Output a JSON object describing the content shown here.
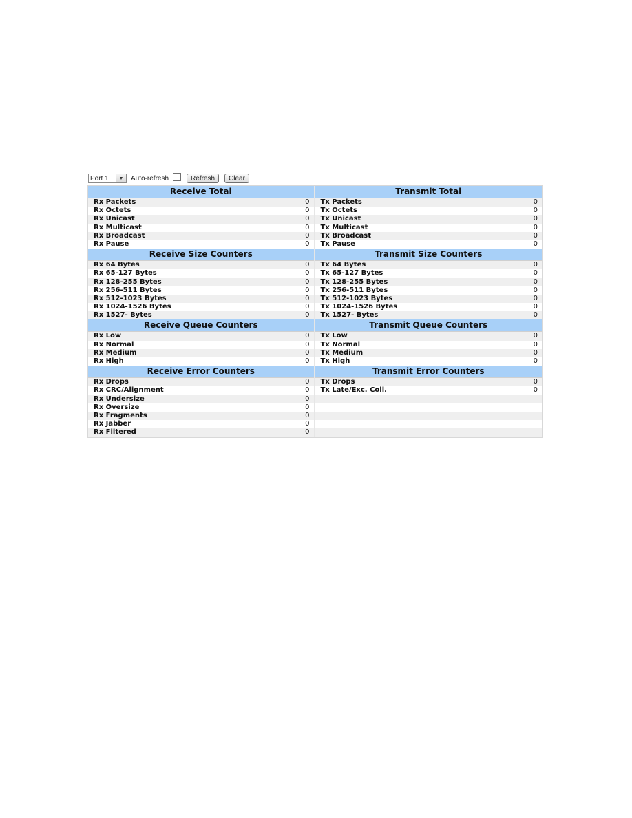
{
  "controls": {
    "port_select": "Port 1",
    "auto_refresh_label": "Auto-refresh",
    "auto_refresh_checked": false,
    "refresh_label": "Refresh",
    "clear_label": "Clear"
  },
  "sections": [
    {
      "rx_title": "Receive Total",
      "tx_title": "Transmit Total",
      "rx": [
        {
          "label": "Rx Packets",
          "value": "0"
        },
        {
          "label": "Rx Octets",
          "value": "0"
        },
        {
          "label": "Rx Unicast",
          "value": "0"
        },
        {
          "label": "Rx Multicast",
          "value": "0"
        },
        {
          "label": "Rx Broadcast",
          "value": "0"
        },
        {
          "label": "Rx Pause",
          "value": "0"
        }
      ],
      "tx": [
        {
          "label": "Tx Packets",
          "value": "0"
        },
        {
          "label": "Tx Octets",
          "value": "0"
        },
        {
          "label": "Tx Unicast",
          "value": "0"
        },
        {
          "label": "Tx Multicast",
          "value": "0"
        },
        {
          "label": "Tx Broadcast",
          "value": "0"
        },
        {
          "label": "Tx Pause",
          "value": "0"
        }
      ]
    },
    {
      "rx_title": "Receive Size Counters",
      "tx_title": "Transmit Size Counters",
      "rx": [
        {
          "label": "Rx 64 Bytes",
          "value": "0"
        },
        {
          "label": "Rx 65-127 Bytes",
          "value": "0"
        },
        {
          "label": "Rx 128-255 Bytes",
          "value": "0"
        },
        {
          "label": "Rx 256-511 Bytes",
          "value": "0"
        },
        {
          "label": "Rx 512-1023 Bytes",
          "value": "0"
        },
        {
          "label": "Rx 1024-1526 Bytes",
          "value": "0"
        },
        {
          "label": "Rx 1527- Bytes",
          "value": "0"
        }
      ],
      "tx": [
        {
          "label": "Tx 64 Bytes",
          "value": "0"
        },
        {
          "label": "Tx 65-127 Bytes",
          "value": "0"
        },
        {
          "label": "Tx 128-255 Bytes",
          "value": "0"
        },
        {
          "label": "Tx 256-511 Bytes",
          "value": "0"
        },
        {
          "label": "Tx 512-1023 Bytes",
          "value": "0"
        },
        {
          "label": "Tx 1024-1526 Bytes",
          "value": "0"
        },
        {
          "label": "Tx 1527- Bytes",
          "value": "0"
        }
      ]
    },
    {
      "rx_title": "Receive Queue Counters",
      "tx_title": "Transmit Queue Counters",
      "rx": [
        {
          "label": "Rx Low",
          "value": "0"
        },
        {
          "label": "Rx Normal",
          "value": "0"
        },
        {
          "label": "Rx Medium",
          "value": "0"
        },
        {
          "label": "Rx High",
          "value": "0"
        }
      ],
      "tx": [
        {
          "label": "Tx Low",
          "value": "0"
        },
        {
          "label": "Tx Normal",
          "value": "0"
        },
        {
          "label": "Tx Medium",
          "value": "0"
        },
        {
          "label": "Tx High",
          "value": "0"
        }
      ]
    },
    {
      "rx_title": "Receive Error Counters",
      "tx_title": "Transmit Error Counters",
      "rx": [
        {
          "label": "Rx Drops",
          "value": "0"
        },
        {
          "label": "Rx CRC/Alignment",
          "value": "0"
        },
        {
          "label": "Rx Undersize",
          "value": "0"
        },
        {
          "label": "Rx Oversize",
          "value": "0"
        },
        {
          "label": "Rx Fragments",
          "value": "0"
        },
        {
          "label": "Rx Jabber",
          "value": "0"
        },
        {
          "label": "Rx Filtered",
          "value": "0"
        }
      ],
      "tx": [
        {
          "label": "Tx Drops",
          "value": "0"
        },
        {
          "label": "Tx Late/Exc. Coll.",
          "value": "0"
        }
      ]
    }
  ]
}
